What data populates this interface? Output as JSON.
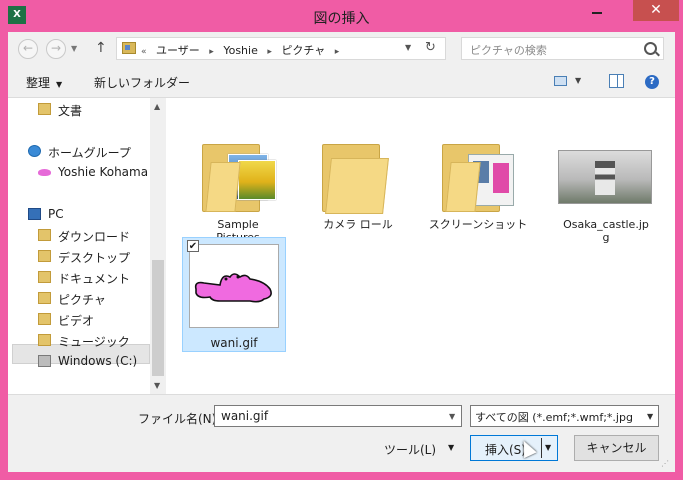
{
  "window": {
    "app_icon_label": "X",
    "title": "図の挿入",
    "close_label": "✕"
  },
  "navbar": {
    "back_glyph": "←",
    "forward_glyph": "→",
    "up_glyph": "↑",
    "breadcrumb_prefix": "«",
    "breadcrumbs": [
      "ユーザー",
      "Yoshie",
      "ピクチャ"
    ],
    "separator": "▸",
    "refresh_glyph": "↻",
    "search_placeholder": "ピクチャの検索"
  },
  "toolbar": {
    "organize_label": "整理",
    "new_folder_label": "新しいフォルダー",
    "help_label": "?"
  },
  "nav_pane": {
    "items": [
      {
        "label": "文書",
        "icon": "folder-icon"
      },
      {
        "label": "ホームグループ",
        "icon": "homegroup-icon"
      },
      {
        "label": "Yoshie Kohama",
        "icon": "user-icon"
      },
      {
        "label": "PC",
        "icon": "pc-icon"
      },
      {
        "label": "ダウンロード",
        "icon": "folder-icon"
      },
      {
        "label": "デスクトップ",
        "icon": "folder-icon"
      },
      {
        "label": "ドキュメント",
        "icon": "folder-icon"
      },
      {
        "label": "ピクチャ",
        "icon": "folder-icon"
      },
      {
        "label": "ビデオ",
        "icon": "folder-icon"
      },
      {
        "label": "ミュージック",
        "icon": "folder-icon"
      },
      {
        "label": "Windows (C:)",
        "icon": "drive-icon"
      }
    ],
    "selected": "Windows (C:)"
  },
  "files": [
    {
      "name": "Sample\nPictures",
      "type": "folder"
    },
    {
      "name": "カメラ ロール",
      "type": "folder"
    },
    {
      "name": "スクリーンショット",
      "type": "folder"
    },
    {
      "name": "Osaka_castle.jp\ng",
      "type": "image"
    },
    {
      "name": "wani.gif",
      "type": "image",
      "selected": true
    }
  ],
  "bottom": {
    "filename_label": "ファイル名(N):",
    "filename_value": "wani.gif",
    "filetype_value": "すべての図 (*.emf;*.wmf;*.jpg",
    "tools_label": "ツール(L)",
    "insert_label": "挿入(S)",
    "cancel_label": "キャンセル"
  },
  "colors": {
    "window_frame": "#f05ca5",
    "selection": "#cce8ff",
    "accent": "#0078d7"
  }
}
